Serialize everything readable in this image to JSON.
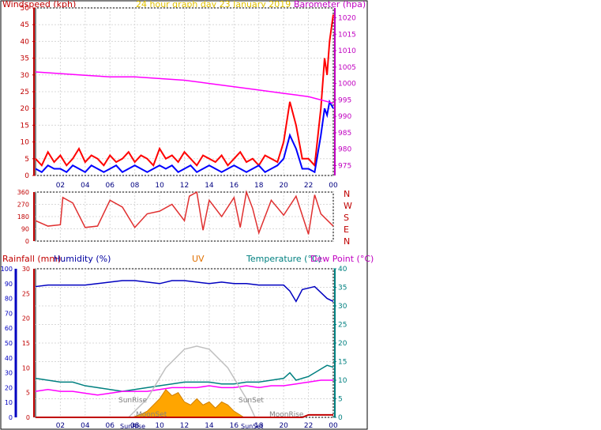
{
  "header": {
    "left_label": "Windspeed (kph)",
    "title": "24 hour graph day   23 January 2019",
    "right_label": "Barometer (hpa)"
  },
  "compass": [
    "N",
    "W",
    "S",
    "E",
    "N"
  ],
  "lower_header": {
    "rainfall": "Rainfall (mm)",
    "humidity": "Humidity (%)",
    "uv": "UV",
    "temperature": "Temperature (°C)",
    "dewpoint": "Dew Point (°C)"
  },
  "annotations": {
    "sunrise": "SunRise",
    "sunset": "SunSet",
    "moonset": "MoonSet",
    "moonrise": "MoonRise"
  },
  "colors": {
    "wind_gust": "#ff0000",
    "wind_avg": "#0000ff",
    "barometer": "#ff00ff",
    "direction": "#e03030",
    "rainfall": "#c00000",
    "humidity": "#0000c0",
    "uv": "#e07000",
    "temperature": "#008080",
    "dewpoint": "#ff00ff",
    "solar": "#ffa500",
    "sun_arc": "#c0c0c0",
    "axis_text": "#000080"
  },
  "chart_data": [
    {
      "type": "line",
      "title": "24 hour graph day   23 January 2019",
      "x_ticks": [
        "02",
        "04",
        "06",
        "08",
        "10",
        "12",
        "14",
        "16",
        "18",
        "20",
        "22",
        "00"
      ],
      "ylabel_left": "Windspeed (kph)",
      "ylim_left": [
        0,
        50
      ],
      "y_ticks_left": [
        0,
        5,
        10,
        15,
        20,
        25,
        30,
        35,
        40,
        45,
        50
      ],
      "ylabel_right": "Barometer (hpa)",
      "ylim_right": [
        972,
        1023
      ],
      "y_ticks_right": [
        975,
        980,
        985,
        990,
        995,
        1000,
        1005,
        1010,
        1015,
        1020
      ],
      "grid": true,
      "series": [
        {
          "name": "Windspeed (kph)",
          "kind": "gust",
          "axis": "left",
          "x": [
            0,
            0.5,
            1,
            1.5,
            2,
            2.5,
            3,
            3.5,
            4,
            4.5,
            5,
            5.5,
            6,
            6.5,
            7,
            7.5,
            8,
            8.5,
            9,
            9.5,
            10,
            10.5,
            11,
            11.5,
            12,
            12.5,
            13,
            13.5,
            14,
            14.5,
            15,
            15.5,
            16,
            16.5,
            17,
            17.5,
            18,
            18.5,
            19,
            19.5,
            20,
            20.5,
            21,
            21.5,
            22,
            22.5,
            23,
            23.3,
            23.5,
            23.7,
            24
          ],
          "y": [
            5,
            3,
            7,
            4,
            6,
            3,
            5,
            8,
            4,
            6,
            5,
            3,
            6,
            4,
            5,
            7,
            4,
            6,
            5,
            3,
            8,
            5,
            6,
            4,
            7,
            5,
            3,
            6,
            5,
            4,
            6,
            3,
            5,
            7,
            4,
            5,
            3,
            6,
            5,
            4,
            10,
            22,
            15,
            5,
            5,
            3,
            20,
            35,
            30,
            40,
            48
          ]
        },
        {
          "name": "Windspeed (kph)",
          "kind": "average",
          "axis": "left",
          "x": [
            0,
            0.5,
            1,
            1.5,
            2,
            2.5,
            3,
            3.5,
            4,
            4.5,
            5,
            5.5,
            6,
            6.5,
            7,
            7.5,
            8,
            8.5,
            9,
            9.5,
            10,
            10.5,
            11,
            11.5,
            12,
            12.5,
            13,
            13.5,
            14,
            14.5,
            15,
            15.5,
            16,
            16.5,
            17,
            17.5,
            18,
            18.5,
            19,
            19.5,
            20,
            20.5,
            21,
            21.5,
            22,
            22.5,
            23,
            23.3,
            23.5,
            23.7,
            24
          ],
          "y": [
            2,
            1,
            3,
            2,
            2,
            1,
            3,
            2,
            1,
            3,
            2,
            1,
            2,
            3,
            1,
            2,
            3,
            2,
            1,
            2,
            3,
            2,
            3,
            1,
            2,
            3,
            1,
            2,
            3,
            2,
            1,
            2,
            3,
            2,
            1,
            2,
            3,
            1,
            2,
            3,
            5,
            12,
            8,
            2,
            2,
            1,
            12,
            20,
            18,
            22,
            20
          ]
        },
        {
          "name": "Barometer (hpa)",
          "axis": "right",
          "x": [
            0,
            2,
            4,
            6,
            8,
            10,
            12,
            14,
            16,
            18,
            19,
            20,
            21,
            22,
            23,
            24
          ],
          "y": [
            1003.5,
            1003,
            1002.5,
            1002,
            1002,
            1001.5,
            1001,
            1000,
            999,
            998,
            997.5,
            997,
            996.5,
            996,
            995,
            994
          ]
        }
      ]
    },
    {
      "type": "line",
      "title": "",
      "ylim": [
        0,
        360
      ],
      "y_ticks": [
        0,
        90,
        180,
        270,
        360
      ],
      "series": [
        {
          "name": "Wind direction",
          "x": [
            0,
            1,
            2,
            2.2,
            3,
            4,
            5,
            6,
            7,
            8,
            9,
            10,
            11,
            12,
            12.4,
            13,
            13.5,
            14,
            15,
            16,
            16.5,
            17,
            17.5,
            18,
            19,
            20,
            21,
            22,
            22.5,
            23,
            24
          ],
          "y": [
            150,
            110,
            120,
            320,
            280,
            100,
            110,
            300,
            250,
            100,
            200,
            220,
            270,
            150,
            330,
            360,
            80,
            300,
            180,
            320,
            100,
            360,
            240,
            60,
            300,
            190,
            330,
            50,
            340,
            200,
            110
          ]
        }
      ]
    },
    {
      "type": "line",
      "title": "",
      "ylim_left_rain": [
        0,
        30
      ],
      "y_ticks_rain": [
        0,
        5,
        10,
        15,
        20,
        25,
        30
      ],
      "ylim_humidity": [
        0,
        100
      ],
      "y_ticks_humidity": [
        0,
        10,
        20,
        30,
        40,
        50,
        60,
        70,
        80,
        90,
        100
      ],
      "ylim_right": [
        0,
        40
      ],
      "y_ticks_right": [
        0,
        5,
        10,
        15,
        20,
        25,
        30,
        35,
        40
      ],
      "series": [
        {
          "name": "Humidity (%)",
          "axis": "humidity",
          "x": [
            0,
            1,
            2,
            3,
            4,
            5,
            6,
            7,
            8,
            9,
            10,
            11,
            12,
            13,
            14,
            15,
            16,
            17,
            18,
            19,
            20,
            20.5,
            21,
            21.5,
            22,
            22.5,
            23,
            23.5,
            24
          ],
          "y": [
            88,
            89,
            89,
            89,
            89,
            90,
            91,
            92,
            92,
            91,
            90,
            92,
            92,
            91,
            90,
            91,
            90,
            90,
            89,
            89,
            89,
            85,
            78,
            86,
            87,
            88,
            84,
            80,
            78
          ]
        },
        {
          "name": "Temperature (°C)",
          "axis": "right",
          "x": [
            0,
            1,
            2,
            3,
            4,
            5,
            6,
            7,
            8,
            9,
            10,
            11,
            12,
            13,
            14,
            15,
            16,
            17,
            18,
            19,
            20,
            20.5,
            21,
            21.5,
            22,
            22.5,
            23,
            23.5,
            24
          ],
          "y": [
            10.5,
            10,
            9.5,
            9.5,
            8.5,
            8,
            7.5,
            7,
            7.5,
            8,
            8.5,
            9,
            9.5,
            9.5,
            9.5,
            9,
            9,
            9.5,
            9.5,
            10,
            10.5,
            12,
            10,
            10.5,
            11,
            12,
            13,
            14,
            13.5
          ]
        },
        {
          "name": "Dew Point (°C)",
          "axis": "right",
          "x": [
            0,
            1,
            2,
            3,
            4,
            5,
            6,
            7,
            8,
            9,
            10,
            11,
            12,
            13,
            14,
            15,
            16,
            17,
            18,
            19,
            20,
            21,
            22,
            23,
            24
          ],
          "y": [
            7,
            7.5,
            7,
            7,
            6.5,
            6,
            6.5,
            7,
            7,
            7,
            7.5,
            8,
            8,
            8,
            8.5,
            8,
            8,
            8.5,
            8,
            8.5,
            8.5,
            9,
            9.5,
            10,
            10
          ]
        },
        {
          "name": "UV",
          "kind": "solar",
          "x": [
            7.8,
            8.5,
            9,
            9.5,
            10,
            10.5,
            11,
            11.5,
            12,
            12.5,
            13,
            13.5,
            14,
            14.5,
            15,
            15.5,
            16,
            16.8
          ],
          "y": [
            0,
            0.5,
            1,
            2,
            3,
            4.5,
            3.5,
            4,
            2.5,
            2,
            3,
            2,
            2.5,
            1.5,
            2.5,
            2,
            1,
            0
          ]
        },
        {
          "name": "Sun arc",
          "kind": "theoretical",
          "x": [
            7.5,
            9,
            10.5,
            12,
            13,
            14,
            15.5,
            17,
            17.7
          ],
          "y": [
            0,
            3,
            8,
            11,
            11.5,
            11,
            8,
            3,
            0
          ]
        },
        {
          "name": "Rainfall (mm)",
          "axis": "left",
          "x": [
            0,
            21.5,
            22,
            24
          ],
          "y": [
            0,
            0,
            0.5,
            0.5
          ]
        }
      ]
    }
  ]
}
